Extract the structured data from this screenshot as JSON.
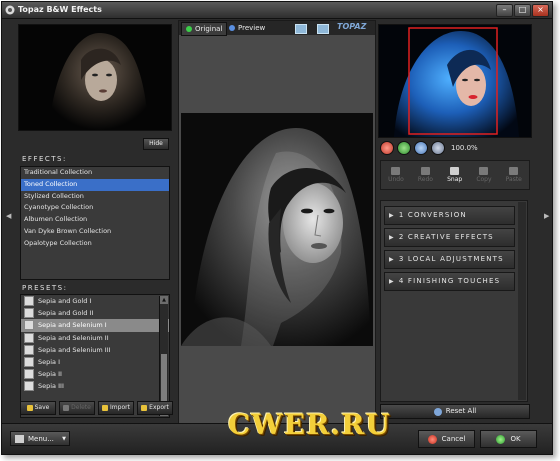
{
  "window": {
    "title": "Topaz B&W Effects",
    "controls": [
      "minimize",
      "maximize",
      "close"
    ]
  },
  "left": {
    "hide_label": "Hide",
    "effects_label": "EFFECTS:",
    "effects": [
      {
        "label": "Traditional Collection",
        "selected": false
      },
      {
        "label": "Toned Collection",
        "selected": true
      },
      {
        "label": "Stylized Collection",
        "selected": false
      },
      {
        "label": "Cyanotype Collection",
        "selected": false
      },
      {
        "label": "Albumen Collection",
        "selected": false
      },
      {
        "label": "Van Dyke Brown Collection",
        "selected": false
      },
      {
        "label": "Opalotype Collection",
        "selected": false
      }
    ],
    "presets_label": "PRESETS:",
    "presets": [
      {
        "label": "Sepia and Gold I",
        "selected": false
      },
      {
        "label": "Sepia and Gold II",
        "selected": false
      },
      {
        "label": "Sepia and Selenium I",
        "selected": true
      },
      {
        "label": "Sepia and Selenium II",
        "selected": false
      },
      {
        "label": "Sepia and Selenium III",
        "selected": false
      },
      {
        "label": "Sepia I",
        "selected": false
      },
      {
        "label": "Sepia II",
        "selected": false
      },
      {
        "label": "Sepia III",
        "selected": false
      }
    ],
    "preset_buttons": {
      "save": "Save",
      "delete": "Delete",
      "import": "Import",
      "export": "Export"
    }
  },
  "center": {
    "tab_original": "Original",
    "tab_preview": "Preview",
    "brand": "TOPAZ",
    "colors": {
      "original_dot": "#3ccf4a",
      "preview_dot": "#5a8fe0"
    }
  },
  "right": {
    "zoom_value": "100.0%",
    "tools": [
      "Undo",
      "Redo",
      "Snap",
      "Copy",
      "Paste"
    ],
    "tool_enabled": "Snap",
    "sections": [
      "1 CONVERSION",
      "2 CREATIVE EFFECTS",
      "3 LOCAL ADJUSTMENTS",
      "4 FINISHING TOUCHES"
    ],
    "reset_label": "Reset All"
  },
  "bottom": {
    "menu_label": "Menu...",
    "cancel_label": "Cancel",
    "ok_label": "OK",
    "watermark": "CWER.RU"
  }
}
